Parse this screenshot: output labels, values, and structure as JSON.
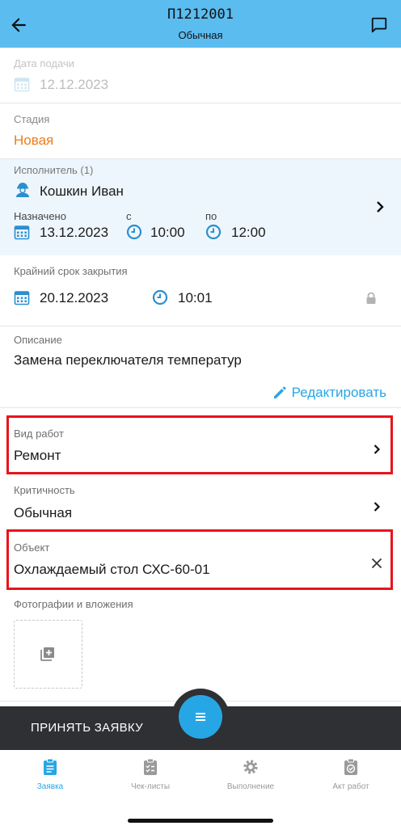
{
  "header": {
    "title": "П1212001",
    "subtitle": "Обычная",
    "back_icon": "arrow-left-icon",
    "chat_icon": "chat-icon"
  },
  "submission": {
    "label": "Дата подачи",
    "date": "12.12.2023"
  },
  "stage": {
    "label": "Стадия",
    "value": "Новая",
    "color": "#f07b1a"
  },
  "executor": {
    "label": "Исполнитель (1)",
    "name": "Кошкин Иван",
    "assigned_label": "Назначено",
    "assigned_date": "13.12.2023",
    "from_label": "с",
    "from_time": "10:00",
    "to_label": "по",
    "to_time": "12:00"
  },
  "deadline": {
    "label": "Крайний срок закрытия",
    "date": "20.12.2023",
    "time": "10:01"
  },
  "description": {
    "label": "Описание",
    "text": "Замена переключателя температур",
    "edit_label": "Редактировать"
  },
  "work_type": {
    "label": "Вид работ",
    "value": "Ремонт"
  },
  "criticality": {
    "label": "Критичность",
    "value": "Обычная"
  },
  "object": {
    "label": "Объект",
    "value": "Охлаждаемый стол СХС-60-01"
  },
  "attachments": {
    "label": "Фотографии и вложения"
  },
  "bottom": {
    "accept_label": "ПРИНЯТЬ ЗАЯВКУ"
  },
  "tabs": [
    {
      "label": "Заявка",
      "icon": "clipboard-icon",
      "active": true
    },
    {
      "label": "Чек-листы",
      "icon": "checklist-icon",
      "active": false
    },
    {
      "label": "Выполнение",
      "icon": "gear-icon",
      "active": false
    },
    {
      "label": "Акт работ",
      "icon": "act-icon",
      "active": false
    }
  ],
  "colors": {
    "header": "#5bbcf0",
    "accent": "#27a6e5",
    "highlight": "#e8141c",
    "bar": "#2f3033"
  }
}
